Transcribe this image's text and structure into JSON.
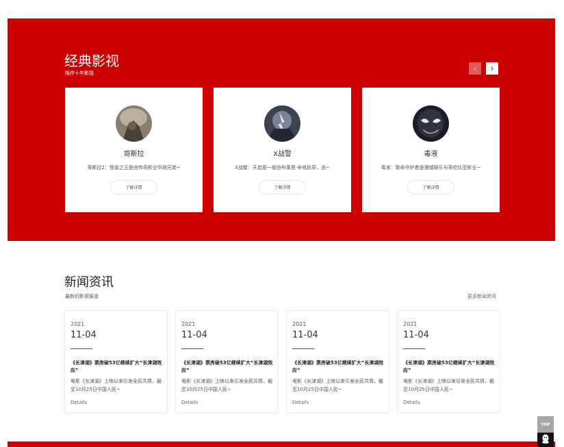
{
  "classic": {
    "title": "经典影视",
    "subtitle": "陪伴十年影视",
    "prev_icon": "chevron-left-icon",
    "next_icon": "chevron-right-icon",
    "prev_glyph": "‹",
    "next_glyph": "›",
    "cards": [
      {
        "name": "哥斯拉",
        "desc": "哥斯拉2：怪兽之王是由传奇影业华纳兄弟~",
        "button": "了解详情"
      },
      {
        "name": "X战警",
        "desc": "X战警：天启是一部由布莱恩·辛格执导，由~",
        "button": "了解详情"
      },
      {
        "name": "毒液",
        "desc": "毒液：致命守护者是漫威娱乐与哥伦比亚影业~",
        "button": "了解详情"
      }
    ]
  },
  "news": {
    "title": "新闻资讯",
    "subtitle": "最新的影视报道",
    "more": "更多新闻资讯",
    "items": [
      {
        "year": "2021",
        "date": "11-04",
        "title": "《长津湖》票房破53亿继续扩大“长津湖效应”",
        "desc": "电影《长津湖》上映以来引发全民共情，截至10月25日中国人民~",
        "details": "Details"
      },
      {
        "year": "2021",
        "date": "11-04",
        "title": "《长津湖》票房破53亿继续扩大“长津湖效应”",
        "desc": "电影《长津湖》上映以来引发全民共情，截至10月25日中国人民~",
        "details": "Details"
      },
      {
        "year": "2021",
        "date": "11-04",
        "title": "《长津湖》票房破53亿继续扩大“长津湖效应”",
        "desc": "电影《长津湖》上映以来引发全民共情，截至10月25日中国人民~",
        "details": "Details"
      },
      {
        "year": "2021",
        "date": "11-04",
        "title": "《长津湖》票房破53亿继续扩大“长津湖效应”",
        "desc": "电影《长津湖》上映以来引发全民共情，截至10月25日中国人民~",
        "details": "Details"
      }
    ]
  },
  "widgets": {
    "top_label": "TOP",
    "qq_icon": "qq-penguin-icon"
  },
  "colors": {
    "brand_red": "#cc0000",
    "white": "#ffffff",
    "top_gray": "#a6a6a6"
  }
}
